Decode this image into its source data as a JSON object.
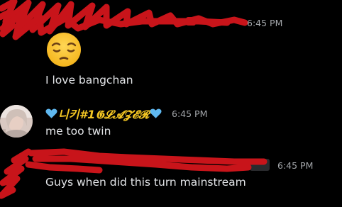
{
  "messages": [
    {
      "timestamp": "6:45 PM",
      "text": "I love bangchan"
    },
    {
      "username": "🩵니키#1𝕲𝓛𝓐𝓩𝓔𝓡🩵",
      "username_text": "니키#1𝕲𝓛𝓐𝓩𝓔𝓡",
      "timestamp": "6:45 PM",
      "text": "me too twin"
    },
    {
      "timestamp": "6:45 PM",
      "text": "Guys when did this turn mainstream"
    }
  ],
  "colors": {
    "background": "#000000",
    "message_text": "#e3e5e8",
    "timestamp": "#a3a6aa",
    "username": "#f3c623",
    "heart": "#5fb8f0",
    "scribble": "#c8141a"
  }
}
